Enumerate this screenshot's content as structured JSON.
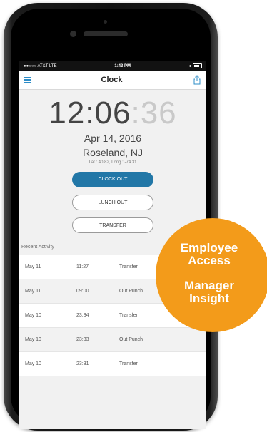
{
  "statusbar": {
    "carrier": "●●○○○ AT&T  LTE",
    "time": "1:43 PM",
    "signal": "◂"
  },
  "navbar": {
    "title": "Clock"
  },
  "clock": {
    "time_main": "12:06",
    "time_seconds": ":36",
    "date": "Apr 14, 2016",
    "location": "Roseland, NJ",
    "coords": "Lat : 40.82, Long : -74.31"
  },
  "buttons": {
    "clock_out": "CLOCK OUT",
    "lunch_out": "LUNCH OUT",
    "transfer": "TRANSFER"
  },
  "recent": {
    "label": "Recent Activity",
    "rows": [
      {
        "date": "May 11",
        "time": "11:27",
        "action": "Transfer"
      },
      {
        "date": "May 11",
        "time": "09:00",
        "action": "Out Punch"
      },
      {
        "date": "May 10",
        "time": "23:34",
        "action": "Transfer"
      },
      {
        "date": "May 10",
        "time": "23:33",
        "action": "Out Punch"
      },
      {
        "date": "May 10",
        "time": "23:31",
        "action": "Transfer"
      }
    ]
  },
  "badge": {
    "top_line1": "Employee",
    "top_line2": "Access",
    "bottom_line1": "Manager",
    "bottom_line2": "Insight"
  },
  "icons": {
    "menu": "hamburger-menu-icon",
    "share": "share-icon",
    "battery": "battery-icon"
  },
  "colors": {
    "accent": "#2277a7",
    "menu_blue": "#2c8cc7",
    "badge_orange": "#f39b1a"
  }
}
